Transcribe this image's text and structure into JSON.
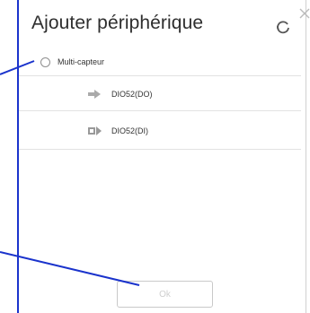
{
  "dialog": {
    "title": "Ajouter périphérique",
    "refresh_icon": "refresh-icon",
    "close_icon": "close-icon"
  },
  "list": {
    "main_item": {
      "label": "Multi-capteur",
      "selected": false
    },
    "sub_items": [
      {
        "label": "DIO52(DO)",
        "icon": "output-arrow-icon"
      },
      {
        "label": "DIO52(DI)",
        "icon": "input-arrow-icon"
      }
    ]
  },
  "footer": {
    "ok_label": "Ok",
    "ok_enabled": false
  },
  "colors": {
    "annotation_line": "#1a33cc",
    "divider": "#e2e2e2",
    "text": "#333333"
  }
}
